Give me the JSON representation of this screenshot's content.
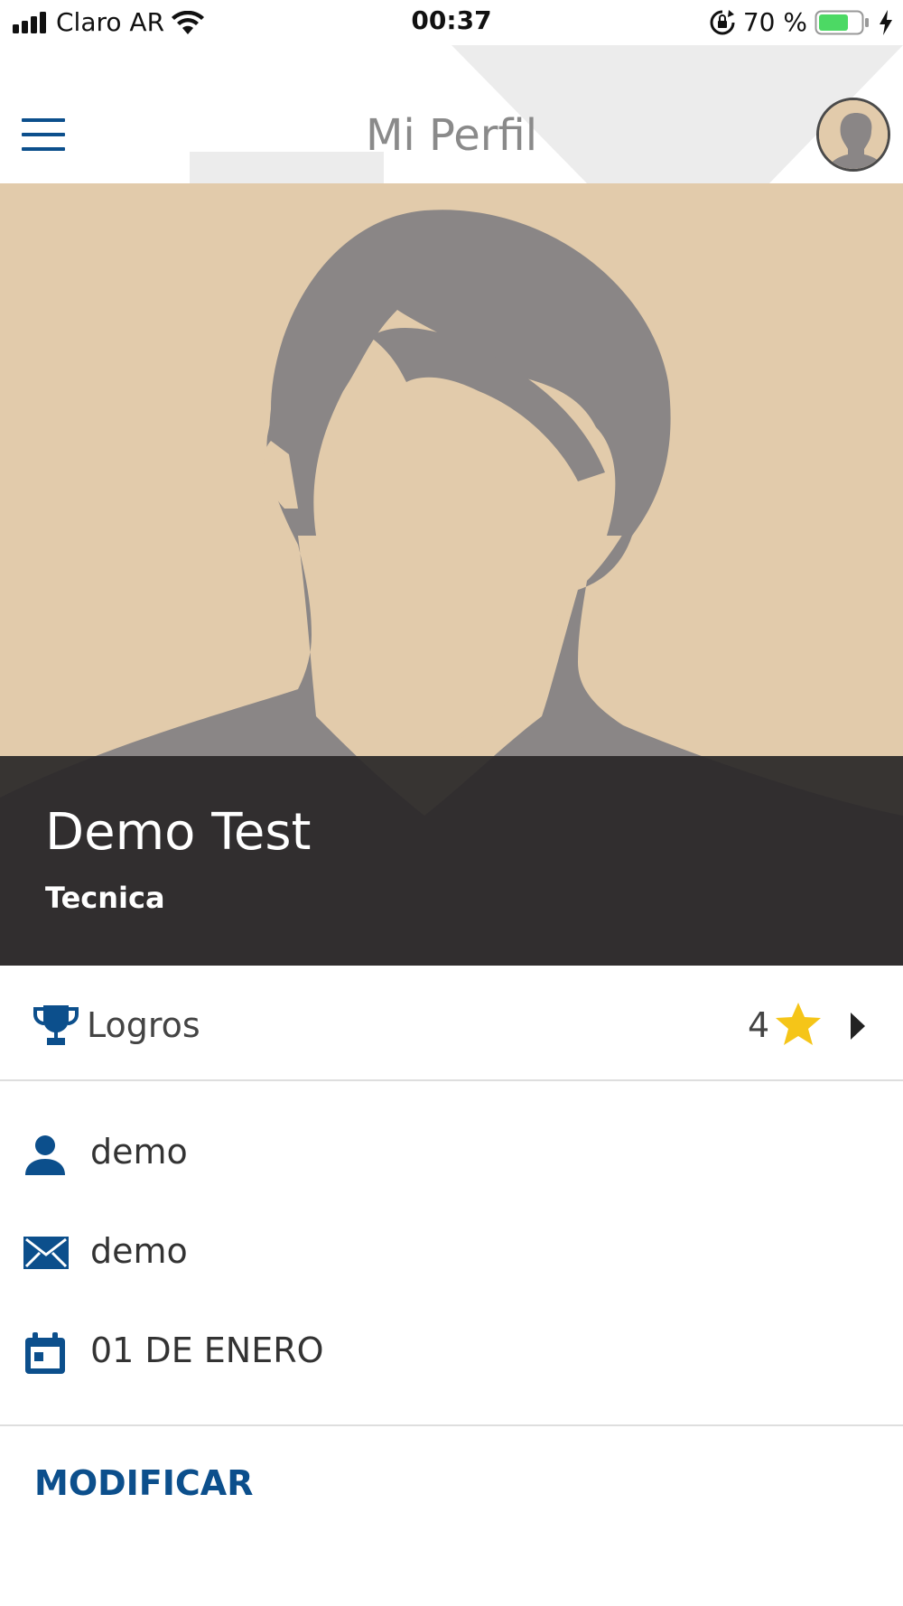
{
  "status_bar": {
    "carrier": "Claro AR",
    "time": "00:37",
    "battery": "70 %",
    "battery_level": 0.7
  },
  "header": {
    "title": "Mi Perfil"
  },
  "profile": {
    "name": "Demo Test",
    "role": "Tecnica"
  },
  "logros": {
    "label": "Logros",
    "count": "4"
  },
  "info": {
    "username": "demo",
    "email": "demo",
    "birthday": "01 DE ENERO"
  },
  "actions": {
    "modify_label": "MODIFICAR"
  },
  "colors": {
    "accent": "#0c4f8c",
    "hero_bg": "#e2cbab",
    "silhouette": "#8a8686",
    "overlay": "#2a2829",
    "star": "#f5c518"
  },
  "icons": [
    "signal-icon",
    "wifi-icon",
    "lock-rotation-icon",
    "battery-icon",
    "charging-icon",
    "hamburger-menu-icon",
    "trophy-icon",
    "star-icon",
    "chevron-right-icon",
    "person-icon",
    "envelope-icon",
    "calendar-icon"
  ]
}
